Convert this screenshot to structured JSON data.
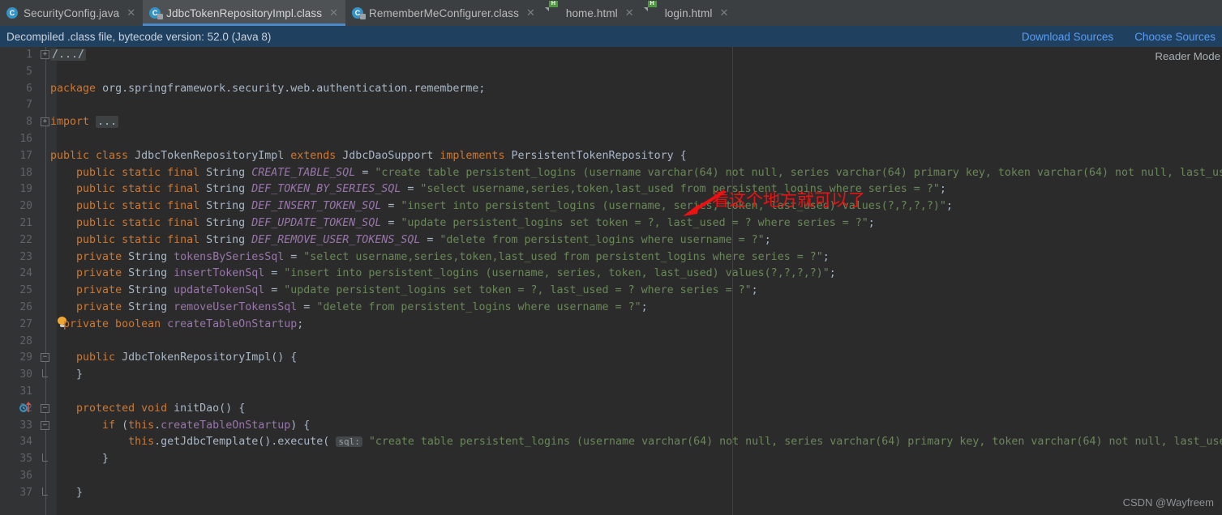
{
  "tabs": [
    {
      "label": "SecurityConfig.java",
      "icon": "java-class-icon",
      "active": false,
      "closable": true
    },
    {
      "label": "JdbcTokenRepositoryImpl.class",
      "icon": "class-file-icon",
      "active": true,
      "closable": true
    },
    {
      "label": "RememberMeConfigurer.class",
      "icon": "class-file-icon",
      "active": false,
      "closable": true
    },
    {
      "label": "home.html",
      "icon": "html-file-icon",
      "active": false,
      "closable": true
    },
    {
      "label": "login.html",
      "icon": "html-file-icon",
      "active": false,
      "closable": true
    }
  ],
  "notification": {
    "message": "Decompiled .class file, bytecode version: 52.0 (Java 8)",
    "download_sources": "Download Sources",
    "choose_sources": "Choose Sources",
    "background": "#204060",
    "link_color": "#589df6"
  },
  "editor": {
    "reader_mode_label": "Reader Mode",
    "background": "#2b2b2b",
    "gutter_background": "#313335",
    "margin_guide_x": 903,
    "lines": [
      {
        "num": "1",
        "fold": "plus",
        "html": "<span class=\"fold-chip cmt\">/.../</span>"
      },
      {
        "num": "5",
        "fold": "",
        "html": ""
      },
      {
        "num": "6",
        "fold": "",
        "html": "<span class=\"kw\">package</span> <span class=\"plain\">org.springframework.security.web.authentication.rememberme;</span>"
      },
      {
        "num": "7",
        "fold": "",
        "html": ""
      },
      {
        "num": "8",
        "fold": "plus",
        "html": "<span class=\"kw\">import</span> <span class=\"fold-chip\">...</span>"
      },
      {
        "num": "16",
        "fold": "",
        "html": ""
      },
      {
        "num": "17",
        "fold": "",
        "html": "<span class=\"kw\">public class</span> <span class=\"plain\">JdbcTokenRepositoryImpl</span> <span class=\"kw\">extends</span> <span class=\"plain\">JdbcDaoSupport</span> <span class=\"kw\">implements</span> <span class=\"plain\">PersistentTokenRepository {</span>"
      },
      {
        "num": "18",
        "fold": "",
        "html": "    <span class=\"kw\">public static final</span> <span class=\"plain\">String</span> <span class=\"sfld\">CREATE_TABLE_SQL</span> <span class=\"plain\">=</span> <span class=\"str\">\"create table persistent_logins (username varchar(64) not null, series varchar(64) primary key, token varchar(64) not null, last_used timestamp not null)\"</span><span class=\"plain\">;</span>"
      },
      {
        "num": "19",
        "fold": "",
        "html": "    <span class=\"kw\">public static final</span> <span class=\"plain\">String</span> <span class=\"sfld\">DEF_TOKEN_BY_SERIES_SQL</span> <span class=\"plain\">=</span> <span class=\"str\">\"select username,series,token,last_used from persistent_logins where series = ?\"</span><span class=\"plain\">;</span>"
      },
      {
        "num": "20",
        "fold": "",
        "html": "    <span class=\"kw\">public static final</span> <span class=\"plain\">String</span> <span class=\"sfld\">DEF_INSERT_TOKEN_SQL</span> <span class=\"plain\">=</span> <span class=\"str\">\"insert into persistent_logins (username, series, token, last_used) values(?,?,?,?)\"</span><span class=\"plain\">;</span>"
      },
      {
        "num": "21",
        "fold": "",
        "html": "    <span class=\"kw\">public static final</span> <span class=\"plain\">String</span> <span class=\"sfld\">DEF_UPDATE_TOKEN_SQL</span> <span class=\"plain\">=</span> <span class=\"str\">\"update persistent_logins set token = ?, last_used = ? where series = ?\"</span><span class=\"plain\">;</span>"
      },
      {
        "num": "22",
        "fold": "",
        "html": "    <span class=\"kw\">public static final</span> <span class=\"plain\">String</span> <span class=\"sfld\">DEF_REMOVE_USER_TOKENS_SQL</span> <span class=\"plain\">=</span> <span class=\"str\">\"delete from persistent_logins where username = ?\"</span><span class=\"plain\">;</span>"
      },
      {
        "num": "23",
        "fold": "",
        "html": "    <span class=\"kw\">private</span> <span class=\"plain\">String</span> <span class=\"fld\">tokensBySeriesSql</span> <span class=\"plain\">=</span> <span class=\"str\">\"select username,series,token,last_used from persistent_logins where series = ?\"</span><span class=\"plain\">;</span>"
      },
      {
        "num": "24",
        "fold": "",
        "html": "    <span class=\"kw\">private</span> <span class=\"plain\">String</span> <span class=\"fld\">insertTokenSql</span> <span class=\"plain\">=</span> <span class=\"str\">\"insert into persistent_logins (username, series, token, last_used) values(?,?,?,?)\"</span><span class=\"plain\">;</span>"
      },
      {
        "num": "25",
        "fold": "",
        "html": "    <span class=\"kw\">private</span> <span class=\"plain\">String</span> <span class=\"fld\">updateTokenSql</span> <span class=\"plain\">=</span> <span class=\"str\">\"update persistent_logins set token = ?, last_used = ? where series = ?\"</span><span class=\"plain\">;</span>"
      },
      {
        "num": "26",
        "fold": "",
        "html": "    <span class=\"kw\">private</span> <span class=\"plain\">String</span> <span class=\"fld\">removeUserTokensSql</span> <span class=\"plain\">=</span> <span class=\"str\">\"delete from persistent_logins where username = ?\"</span><span class=\"plain\">;</span>"
      },
      {
        "num": "27",
        "fold": "",
        "html": "  <span class=\"kw\">private boolean</span> <span class=\"fld\">createTableOnStartup</span><span class=\"plain\">;</span>",
        "bulb": true
      },
      {
        "num": "28",
        "fold": "",
        "html": ""
      },
      {
        "num": "29",
        "fold": "minus",
        "html": "    <span class=\"kw\">public</span> <span class=\"plain\">JdbcTokenRepositoryImpl() {</span>"
      },
      {
        "num": "30",
        "fold": "end",
        "html": "    <span class=\"plain\">}</span>"
      },
      {
        "num": "31",
        "fold": "",
        "html": ""
      },
      {
        "num": "32",
        "fold": "minus",
        "html": "    <span class=\"kw\">protected void</span> <span class=\"mth\">initDao</span><span class=\"plain\">() {</span>",
        "override": true
      },
      {
        "num": "33",
        "fold": "minus",
        "html": "        <span class=\"kw\">if</span> <span class=\"plain\">(</span><span class=\"kw\">this</span><span class=\"plain\">.</span><span class=\"fld\">createTableOnStartup</span><span class=\"plain\">) {</span>"
      },
      {
        "num": "34",
        "fold": "",
        "html": "            <span class=\"kw\">this</span><span class=\"plain\">.</span><span class=\"mth\">getJdbcTemplate</span><span class=\"plain\">().</span><span class=\"mth\">execute</span><span class=\"plain\">(</span> <span class=\"hint\">sql:</span> <span class=\"str\">\"create table persistent_logins (username varchar(64) not null, series varchar(64) primary key, token varchar(64) not null, last_used timestamp not null)\"</span><span class=\"plain\">);</span>"
      },
      {
        "num": "35",
        "fold": "end",
        "html": "        <span class=\"plain\">}</span>"
      },
      {
        "num": "36",
        "fold": "",
        "html": ""
      },
      {
        "num": "37",
        "fold": "end",
        "html": "    <span class=\"plain\">}</span>"
      }
    ]
  },
  "annotation": {
    "text": "看这个地方就可以了",
    "color": "#ee1111",
    "arrow": "arrow-down-left"
  },
  "watermark": {
    "text": "CSDN @Wayfreem"
  }
}
